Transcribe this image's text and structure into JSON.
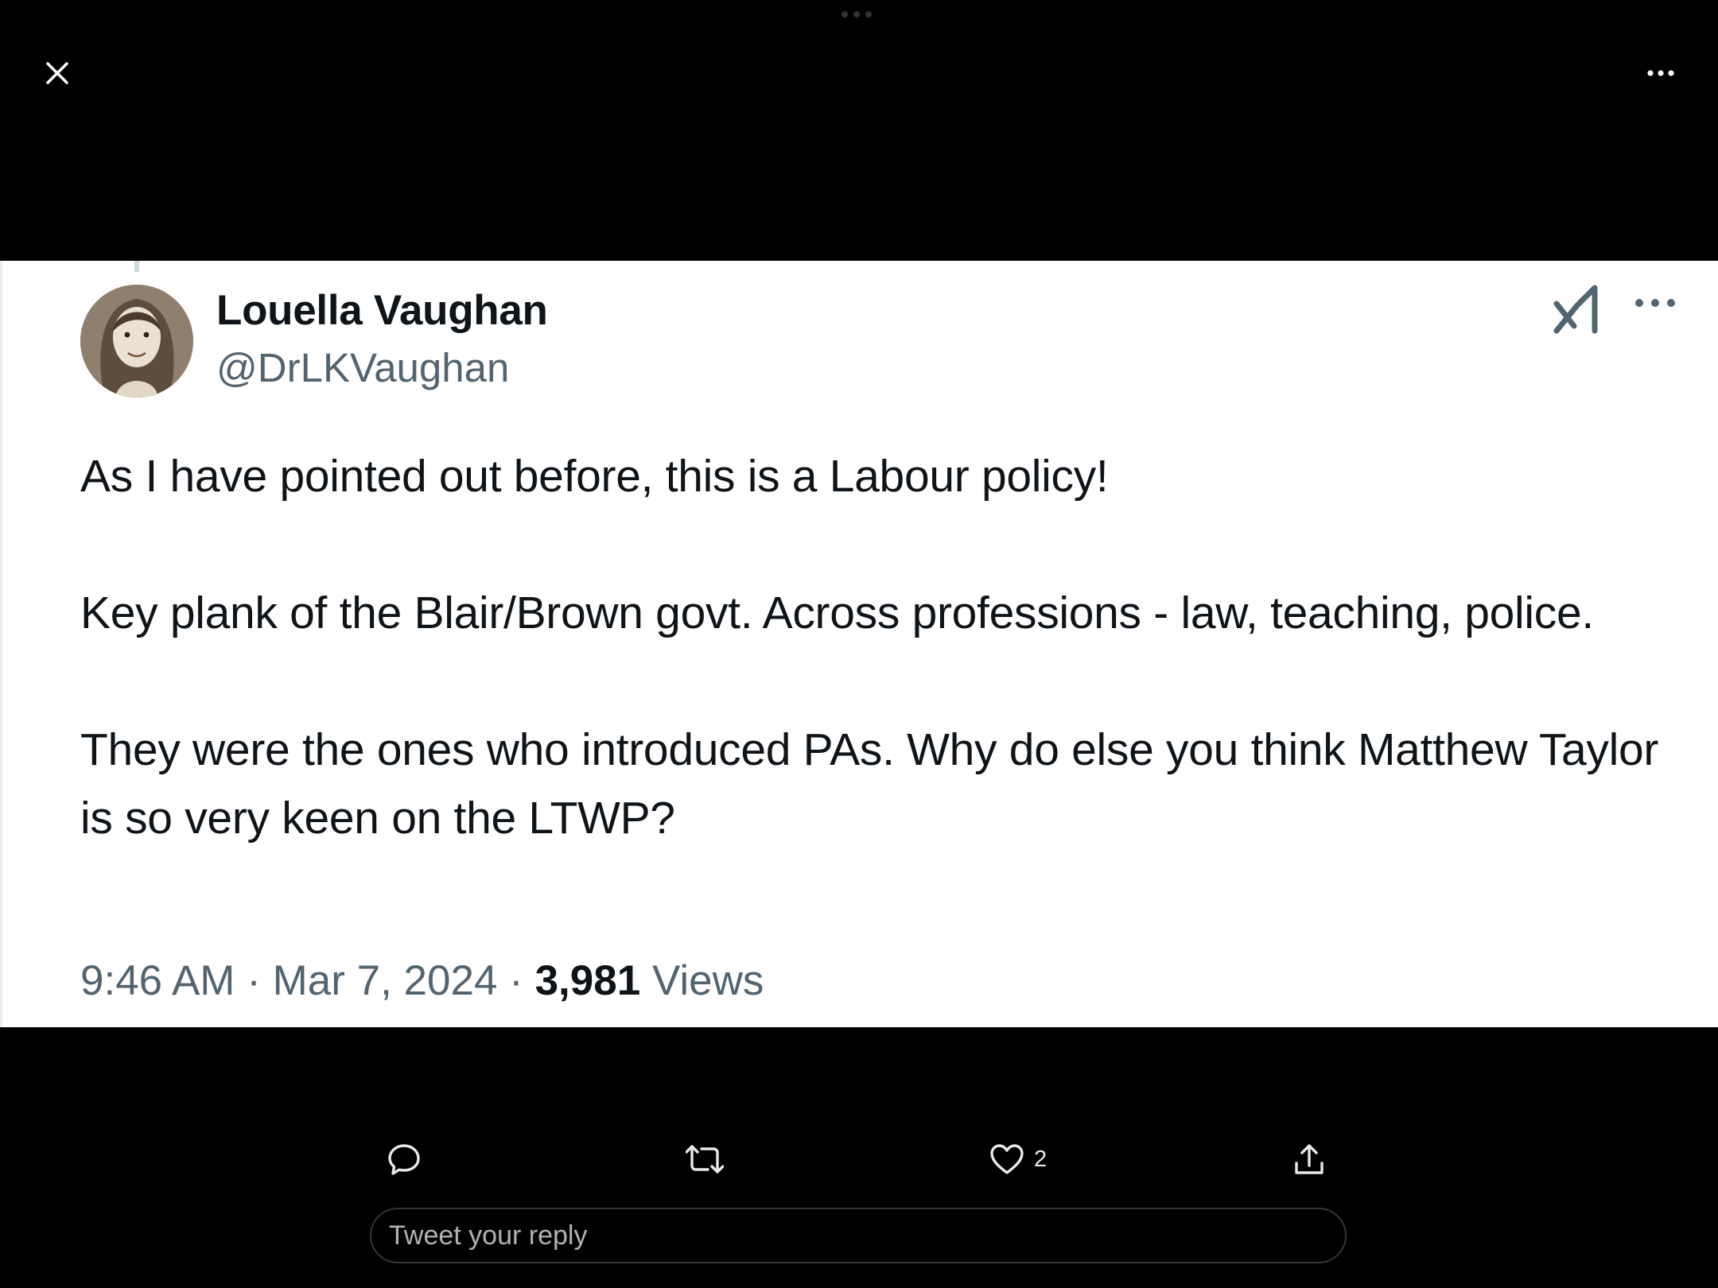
{
  "tweet": {
    "author_name": "Louella Vaughan",
    "author_handle": "@DrLKVaughan",
    "paragraphs": [
      "As I have pointed out before, this is a Labour policy!",
      "Key plank of the Blair/Brown govt. Across professions - law, teaching, police.",
      "They were the ones who introduced PAs. Why do else you think Matthew Taylor is so very keen on the LTWP?"
    ],
    "time": "9:46 AM",
    "separator": "·",
    "date": "Mar 7, 2024",
    "views_count": "3,981",
    "views_label": "Views"
  },
  "actions": {
    "like_count": "2"
  },
  "reply": {
    "placeholder": "Tweet your reply"
  },
  "icons": {
    "close": "close-icon",
    "more": "more-horizontal-icon",
    "grok": "grok-icon",
    "reply": "comment-icon",
    "retweet": "retweet-icon",
    "like": "heart-icon",
    "share": "share-icon"
  },
  "colors": {
    "background": "#000000",
    "card": "#ffffff",
    "primary_text": "#0f1419",
    "secondary_text": "#536471",
    "icon_light": "#e7e9ea"
  }
}
